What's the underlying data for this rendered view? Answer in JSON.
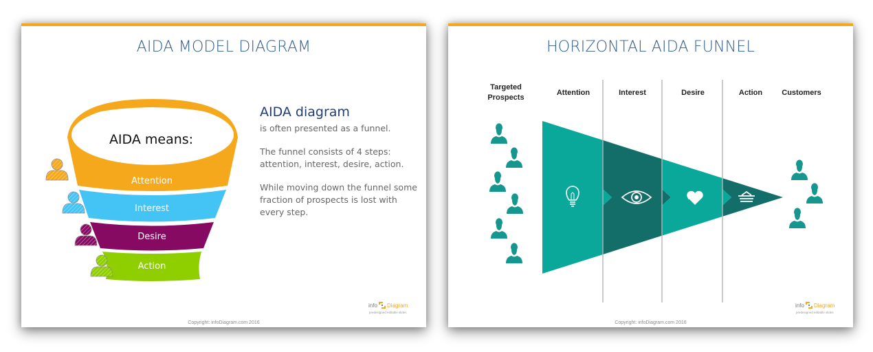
{
  "colors": {
    "accent_bar": "#f5a81c",
    "title": "#2e5a8c",
    "attention": "#f5a81c",
    "interest": "#44c3f5",
    "desire": "#860a62",
    "action": "#8fcf00",
    "teal_light": "#0aa89a",
    "teal_dark": "#136e6a",
    "person_teal": "#15968e"
  },
  "left_slide": {
    "title": "AIDA MODEL DIAGRAM",
    "funnel": {
      "top_label": "AIDA means:",
      "steps": [
        {
          "label": "Attention",
          "color": "#f5a81c"
        },
        {
          "label": "Interest",
          "color": "#44c3f5"
        },
        {
          "label": "Desire",
          "color": "#860a62"
        },
        {
          "label": "Action",
          "color": "#8fcf00"
        }
      ]
    },
    "side_text": {
      "heading": "AIDA diagram",
      "paragraphs": [
        "is often presented as a funnel.",
        "The funnel consists of 4 steps: attention, interest, desire, action.",
        "While moving down the funnel some fraction of prospects is lost with every step."
      ]
    },
    "copyright": "Copyright: infoDiagram.com 2016",
    "logo": {
      "info": "info",
      "diagram": "Diagram",
      "tagline": "predesigned editable slides"
    }
  },
  "right_slide": {
    "title": "HORIZONTAL AIDA FUNNEL",
    "columns": [
      {
        "label": "Targeted Prospects"
      },
      {
        "label": "Attention",
        "icon": "lightbulb-icon"
      },
      {
        "label": "Interest",
        "icon": "eye-icon"
      },
      {
        "label": "Desire",
        "icon": "heart-icon"
      },
      {
        "label": "Action",
        "icon": "basket-icon"
      },
      {
        "label": "Customers"
      }
    ],
    "prospect_count": 6,
    "customer_count": 3,
    "copyright": "Copyright: infoDiagram.com 2016",
    "logo": {
      "info": "info",
      "diagram": "Diagram",
      "tagline": "predesigned editable slides"
    }
  }
}
